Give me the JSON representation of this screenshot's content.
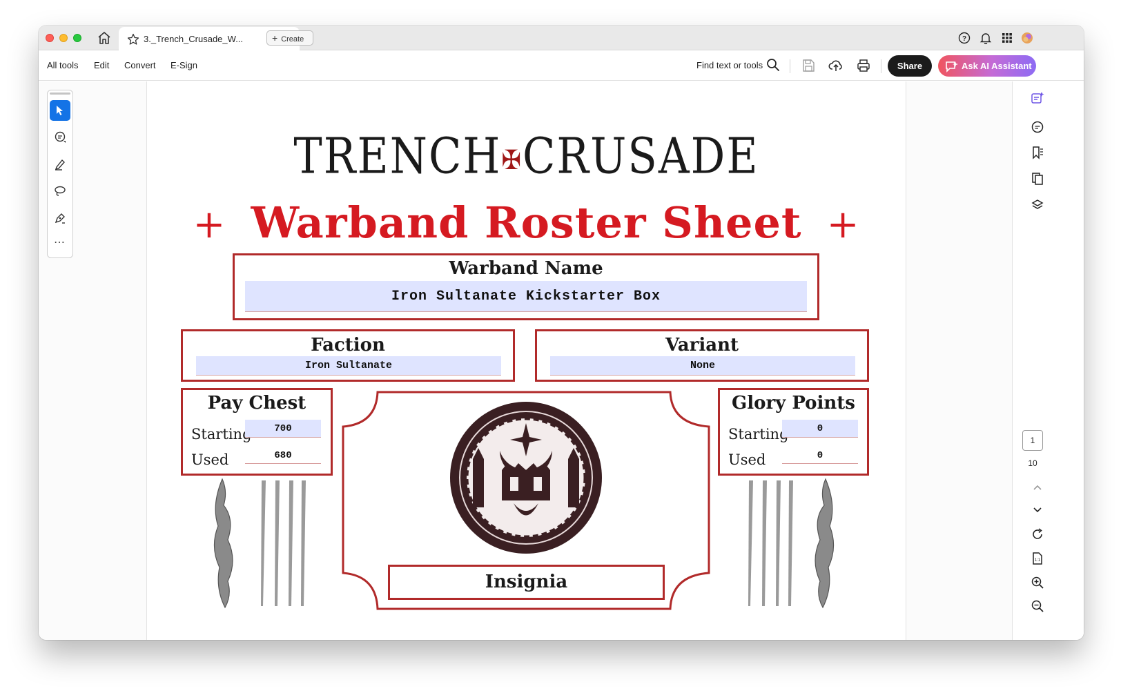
{
  "window": {
    "tab_title": "3._Trench_Crusade_W...",
    "tab_close": "✕",
    "create_label": "Create"
  },
  "toolbar": {
    "menu": [
      "All tools",
      "Edit",
      "Convert",
      "E-Sign"
    ],
    "find_label": "Find text or tools",
    "share_label": "Share",
    "ai_label": "Ask AI Assistant"
  },
  "tool_rail": {
    "tools": [
      "select-icon",
      "comment-icon",
      "highlight-pen-icon",
      "lasso-icon",
      "sign-pen-icon"
    ],
    "more": "⋯"
  },
  "right_rail": {
    "icons": [
      "ai-summary-icon",
      "comment-panel-icon",
      "bookmark-icon",
      "copy-pages-icon",
      "layers-icon",
      "rotate-icon",
      "fit-page-icon",
      "zoom-in-icon",
      "zoom-out-icon"
    ],
    "current_page": "1",
    "total_pages": "10"
  },
  "document": {
    "title_left": "TRENCH",
    "title_cross": "✠",
    "title_right": "CRUSADE",
    "subtitle_plus": "+",
    "subtitle": "Warband Roster Sheet",
    "warband_name_label": "Warband Name",
    "warband_name": "Iron Sultanate Kickstarter Box",
    "faction_label": "Faction",
    "faction": "Iron Sultanate",
    "variant_label": "Variant",
    "variant": "None",
    "pay_chest": {
      "label": "Pay Chest",
      "starting_label": "Starting",
      "starting": "700",
      "used_label": "Used",
      "used": "680"
    },
    "glory_points": {
      "label": "Glory Points",
      "starting_label": "Starting",
      "starting": "0",
      "used_label": "Used",
      "used": "0"
    },
    "insignia_label": "Insignia"
  },
  "colors": {
    "accent_red": "#d51a21",
    "border_red": "#b12a2a",
    "field_blue": "#dfe4ff",
    "share_bg": "#1b1b1b",
    "tool_active": "#1473e6"
  }
}
